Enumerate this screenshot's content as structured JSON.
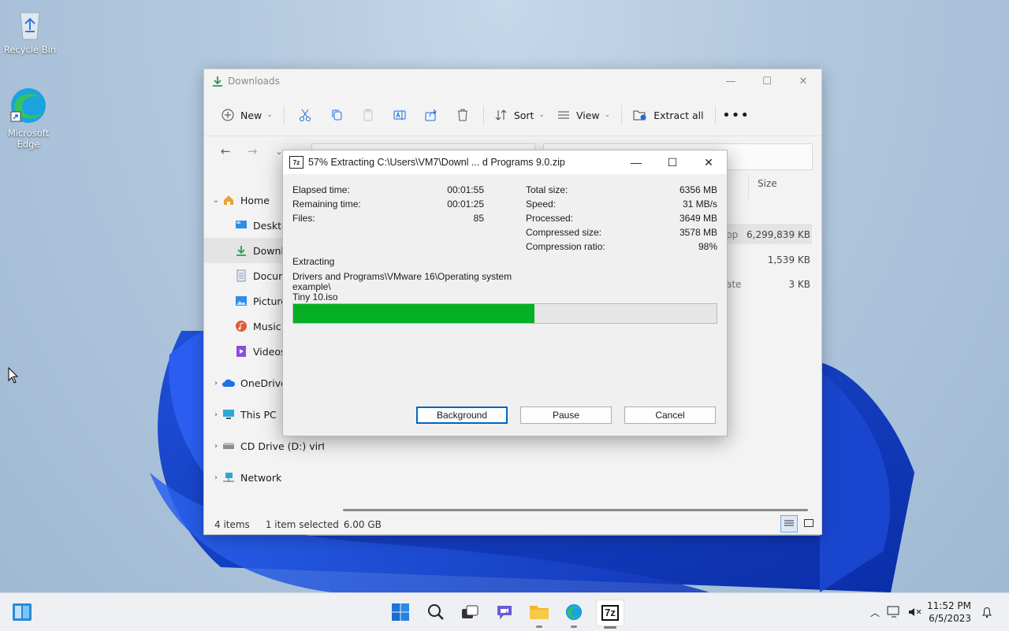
{
  "desktop": {
    "icons": [
      {
        "label": "Recycle Bin",
        "icon": "recycle-bin-icon"
      },
      {
        "label": "Microsoft Edge",
        "icon": "edge-icon"
      }
    ]
  },
  "explorer": {
    "title": "Downloads",
    "toolbar": {
      "new_label": "New",
      "sort_label": "Sort",
      "view_label": "View",
      "extract_label": "Extract all"
    },
    "nav": [
      {
        "label": "Home",
        "icon": "home-icon"
      },
      {
        "label": "Desktop",
        "icon": "desktop-icon"
      },
      {
        "label": "Downloads",
        "icon": "download-icon"
      },
      {
        "label": "Documents",
        "icon": "documents-icon"
      },
      {
        "label": "Pictures",
        "icon": "pictures-icon"
      },
      {
        "label": "Music",
        "icon": "music-icon"
      },
      {
        "label": "Videos",
        "icon": "videos-icon"
      },
      {
        "label": "OneDrive",
        "icon": "onedrive-icon"
      },
      {
        "label": "This PC",
        "icon": "pc-icon"
      },
      {
        "label": "CD Drive (D:) virtio-w",
        "icon": "cd-drive-icon"
      },
      {
        "label": "Network",
        "icon": "network-icon"
      }
    ],
    "columns": {
      "size": "Size"
    },
    "rows": [
      {
        "name_fragment": "pp",
        "size": "6,299,839 KB"
      },
      {
        "name_fragment": "",
        "size": "1,539 KB"
      },
      {
        "name_fragment": "ate",
        "size": "3 KB"
      }
    ],
    "status": {
      "items": "4 items",
      "selected": "1 item selected",
      "size": "6.00 GB"
    }
  },
  "dialog": {
    "title": "57% Extracting C:\\Users\\VM7\\Downl ... d Programs 9.0.zip",
    "app_icon_text": "7z",
    "left_stats": [
      {
        "label": "Elapsed time:",
        "value": "00:01:55"
      },
      {
        "label": "Remaining time:",
        "value": "00:01:25"
      },
      {
        "label": "Files:",
        "value": "85"
      }
    ],
    "right_stats": [
      {
        "label": "Total size:",
        "value": "6356 MB"
      },
      {
        "label": "Speed:",
        "value": "31 MB/s"
      },
      {
        "label": "Processed:",
        "value": "3649 MB"
      },
      {
        "label": "Compressed size:",
        "value": "3578 MB"
      },
      {
        "label": "Compression ratio:",
        "value": "98%"
      }
    ],
    "operation": "Extracting",
    "current_path_line1": "Drivers and Programs\\VMware 16\\Operating system example\\",
    "current_path_line2": "Tiny 10.iso",
    "progress": 0.57,
    "progress_color": "#06b025",
    "buttons": {
      "background": "Background",
      "pause": "Pause",
      "cancel": "Cancel"
    }
  },
  "taskbar": {
    "apps": [
      {
        "name": "start-button"
      },
      {
        "name": "search-icon"
      },
      {
        "name": "task-view-icon"
      },
      {
        "name": "teams-chat-icon"
      },
      {
        "name": "file-explorer-icon"
      },
      {
        "name": "edge-icon"
      },
      {
        "name": "7zip-icon",
        "text": "7z"
      }
    ],
    "clock": {
      "time": "11:52 PM",
      "date": "6/5/2023"
    }
  }
}
